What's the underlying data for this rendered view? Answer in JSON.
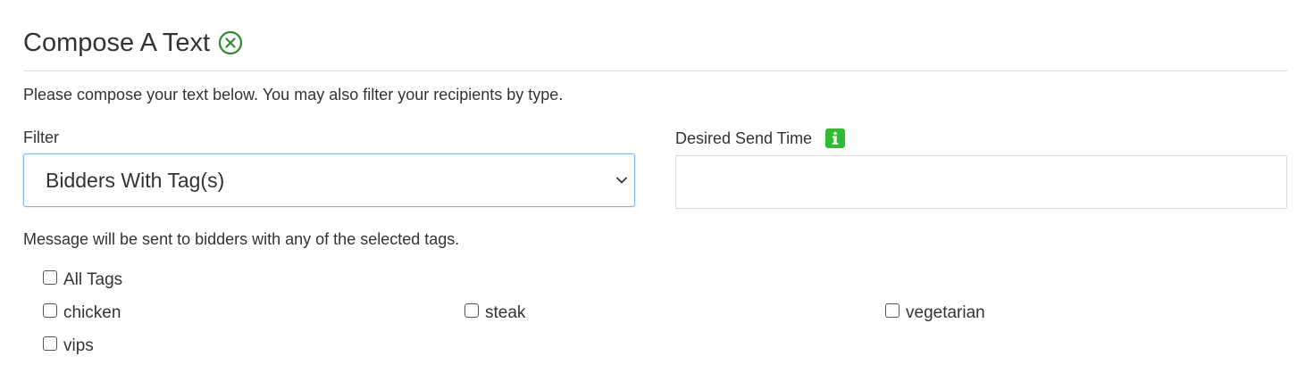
{
  "header": {
    "title": "Compose A Text"
  },
  "intro": "Please compose your text below. You may also filter your recipients by type.",
  "filter": {
    "label": "Filter",
    "selected": "Bidders With Tag(s)"
  },
  "send_time": {
    "label": "Desired Send Time",
    "value": ""
  },
  "note": "Message will be sent to bidders with any of the selected tags.",
  "tags": {
    "all": {
      "label": "All Tags",
      "checked": false
    },
    "chicken": {
      "label": "chicken",
      "checked": false
    },
    "steak": {
      "label": "steak",
      "checked": false
    },
    "vegetarian": {
      "label": "vegetarian",
      "checked": false
    },
    "vips": {
      "label": "vips",
      "checked": false
    }
  },
  "colors": {
    "close_icon": "#2e8b2e",
    "info_icon": "#2ebd2e",
    "select_border": "#7fb6e9"
  }
}
